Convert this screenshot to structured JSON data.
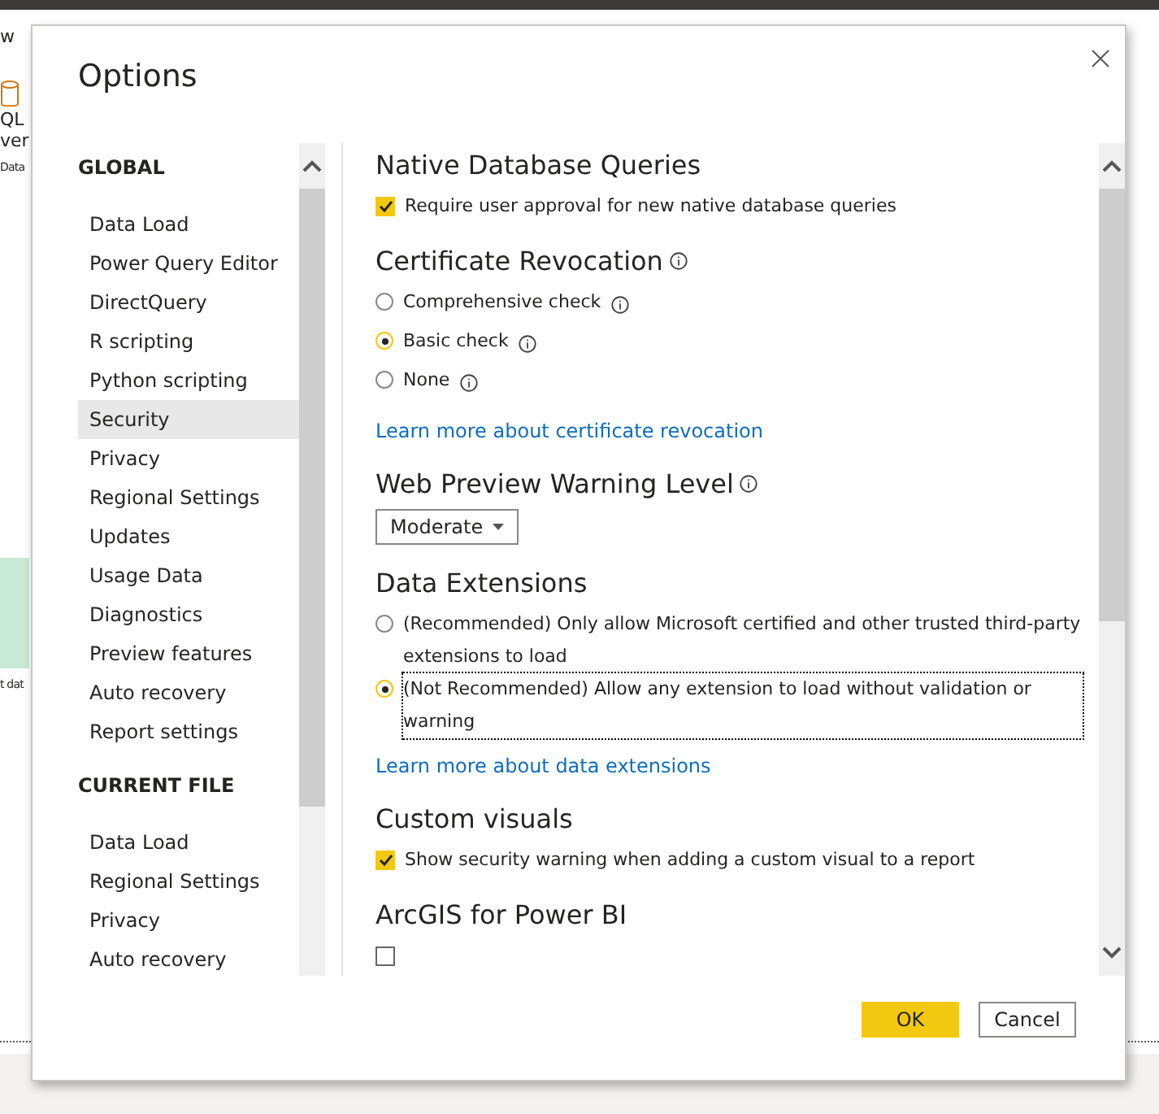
{
  "background": {
    "ribbon_texts": [
      "w",
      "QL",
      "ver",
      "Data"
    ],
    "canvas_text": "t dat"
  },
  "dialog": {
    "title": "Options",
    "nav": [
      {
        "heading": "GLOBAL",
        "items": [
          {
            "label": "Data Load",
            "selected": false
          },
          {
            "label": "Power Query Editor",
            "selected": false
          },
          {
            "label": "DirectQuery",
            "selected": false
          },
          {
            "label": "R scripting",
            "selected": false
          },
          {
            "label": "Python scripting",
            "selected": false
          },
          {
            "label": "Security",
            "selected": true
          },
          {
            "label": "Privacy",
            "selected": false
          },
          {
            "label": "Regional Settings",
            "selected": false
          },
          {
            "label": "Updates",
            "selected": false
          },
          {
            "label": "Usage Data",
            "selected": false
          },
          {
            "label": "Diagnostics",
            "selected": false
          },
          {
            "label": "Preview features",
            "selected": false
          },
          {
            "label": "Auto recovery",
            "selected": false
          },
          {
            "label": "Report settings",
            "selected": false
          }
        ]
      },
      {
        "heading": "CURRENT FILE",
        "items": [
          {
            "label": "Data Load",
            "selected": false
          },
          {
            "label": "Regional Settings",
            "selected": false
          },
          {
            "label": "Privacy",
            "selected": false
          },
          {
            "label": "Auto recovery",
            "selected": false
          }
        ]
      }
    ],
    "sections": [
      {
        "title": "Native Database Queries",
        "info": false,
        "controls": [
          {
            "kind": "checkbox",
            "label": "Require user approval for new native database queries",
            "checked": true
          }
        ]
      },
      {
        "title": "Certificate Revocation",
        "info": true,
        "controls": [
          {
            "kind": "radio",
            "label": "Comprehensive check",
            "info": true,
            "selected": false
          },
          {
            "kind": "radio",
            "label": "Basic check",
            "info": true,
            "selected": true
          },
          {
            "kind": "radio",
            "label": "None",
            "info": true,
            "selected": false
          },
          {
            "kind": "link",
            "label": "Learn more about certificate revocation"
          }
        ]
      },
      {
        "title": "Web Preview Warning Level",
        "info": true,
        "controls": [
          {
            "kind": "dropdown",
            "label": "Moderate"
          }
        ]
      },
      {
        "title": "Data Extensions",
        "info": false,
        "controls": [
          {
            "kind": "radio",
            "label": "(Recommended) Only allow Microsoft certified and other trusted third-party extensions to load",
            "info": false,
            "selected": false
          },
          {
            "kind": "radio",
            "label": "(Not Recommended) Allow any extension to load without validation or warning",
            "info": false,
            "selected": true,
            "focused": true
          },
          {
            "kind": "link",
            "label": "Learn more about data extensions"
          }
        ]
      },
      {
        "title": "Custom visuals",
        "info": false,
        "controls": [
          {
            "kind": "checkbox",
            "label": "Show security warning when adding a custom visual to a report",
            "checked": true
          }
        ]
      },
      {
        "title": "ArcGIS for Power BI",
        "info": false,
        "controls": [
          {
            "kind": "checkbox",
            "checked": false
          }
        ]
      }
    ],
    "buttons": [
      {
        "label": "OK",
        "kind": "primary"
      },
      {
        "label": "Cancel",
        "kind": "secondary"
      }
    ]
  }
}
